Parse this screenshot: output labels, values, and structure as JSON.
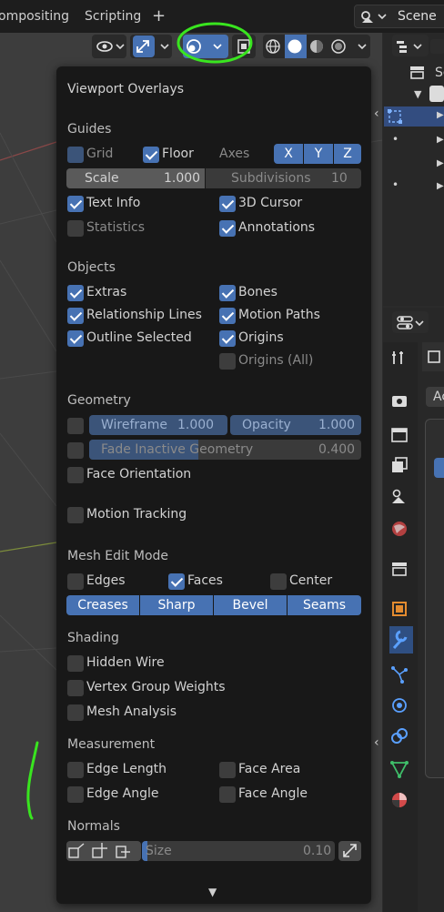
{
  "top_bar": {
    "tab_compositing": "ompositing",
    "tab_scripting": "Scripting",
    "add_tab": "+",
    "scene_label": "Scene"
  },
  "popover": {
    "title": "Viewport Overlays",
    "guides": {
      "header": "Guides",
      "grid": "Grid",
      "floor": "Floor",
      "axes": "Axes",
      "axis_x": "X",
      "axis_y": "Y",
      "axis_z": "Z",
      "scale_label": "Scale",
      "scale_value": "1.000",
      "subdivisions_label": "Subdivisions",
      "subdivisions_value": "10",
      "text_info": "Text Info",
      "cursor_3d": "3D Cursor",
      "statistics": "Statistics",
      "annotations": "Annotations"
    },
    "objects": {
      "header": "Objects",
      "extras": "Extras",
      "bones": "Bones",
      "relationship_lines": "Relationship Lines",
      "motion_paths": "Motion Paths",
      "outline_selected": "Outline Selected",
      "origins": "Origins",
      "origins_all": "Origins (All)"
    },
    "geometry": {
      "header": "Geometry",
      "wireframe_label": "Wireframe",
      "wireframe_value": "1.000",
      "opacity_label": "Opacity",
      "opacity_value": "1.000",
      "fade_label": "Fade Inactive Geometry",
      "fade_value": "0.400",
      "face_orientation": "Face Orientation"
    },
    "motion_tracking": "Motion Tracking",
    "mesh_edit": {
      "header": "Mesh Edit Mode",
      "edges": "Edges",
      "faces": "Faces",
      "center": "Center",
      "creases": "Creases",
      "sharp": "Sharp",
      "bevel": "Bevel",
      "seams": "Seams"
    },
    "shading": {
      "header": "Shading",
      "hidden_wire": "Hidden Wire",
      "vertex_group_weights": "Vertex Group Weights",
      "mesh_analysis": "Mesh Analysis"
    },
    "measurement": {
      "header": "Measurement",
      "edge_length": "Edge Length",
      "face_area": "Face Area",
      "edge_angle": "Edge Angle",
      "face_angle": "Face Angle"
    },
    "normals": {
      "header": "Normals",
      "size_label": "Size",
      "size_value": "0.10"
    },
    "more_arrow": "▼"
  },
  "right_panel": {
    "outliner_partial": "Sc",
    "props_partial": "Ac"
  },
  "colors": {
    "accent_blue": "#4772b3",
    "popover_bg": "#181818",
    "annotation_green": "#39e51f"
  },
  "icons": [
    "visibility-icon",
    "gizmo-icon",
    "overlay-icon",
    "xray-icon",
    "wireframe-shading-icon",
    "solid-shading-icon",
    "material-shading-icon",
    "rendered-shading-icon",
    "tool-icon",
    "render-icon",
    "output-icon",
    "view-layer-icon",
    "scene-icon",
    "world-icon",
    "collection-icon",
    "object-icon",
    "modifier-icon",
    "particles-icon",
    "physics-icon",
    "constraints-icon",
    "data-icon",
    "material-icon"
  ]
}
